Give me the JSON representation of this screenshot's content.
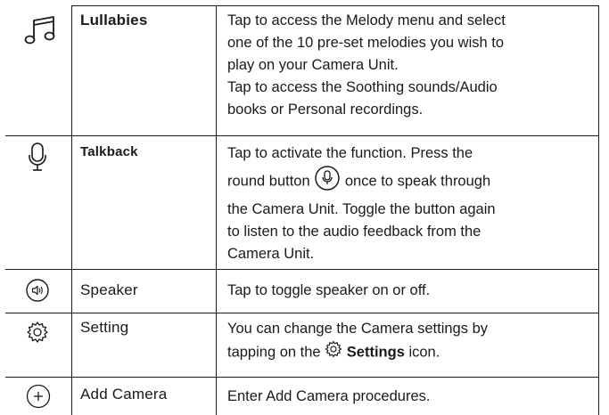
{
  "rows": [
    {
      "icon": "music-note-icon",
      "feature": "Lullabies",
      "description_lines": [
        "Tap to access the Melody menu and select",
        "one of the 10 pre-set melodies you wish to",
        "play on your Camera Unit.",
        "Tap to access the Soothing sounds/Audio",
        "books or Personal recordings."
      ]
    },
    {
      "icon": "microphone-icon",
      "feature": "Talkback",
      "description_lines": [
        "Tap to activate the function. Press the",
        "round button",
        "once to speak through",
        "the Camera Unit. Toggle the button again",
        "to listen to the audio feedback from the",
        "Camera Unit."
      ]
    },
    {
      "icon": "speaker-icon",
      "feature": "Speaker",
      "description_lines": [
        "Tap to toggle speaker on or off."
      ]
    },
    {
      "icon": "gear-icon",
      "feature": "Setting",
      "description_lines": [
        "You can change the Camera settings by",
        "tapping on the",
        "Settings",
        "icon."
      ]
    },
    {
      "icon": "plus-circle-icon",
      "feature": "Add Camera",
      "description_lines": [
        "Enter Add Camera procedures."
      ]
    }
  ]
}
